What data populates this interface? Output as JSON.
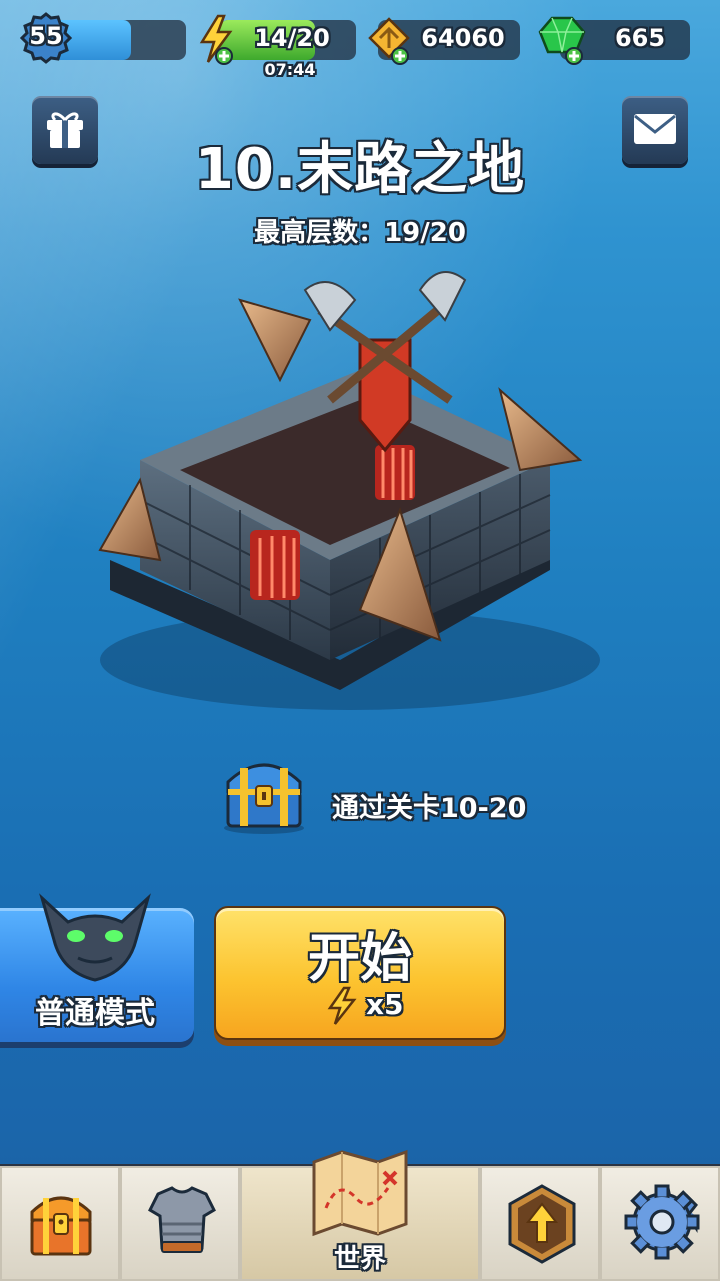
{
  "hud": {
    "player_level": "55",
    "xp_progress": 0.6,
    "energy": "14/20",
    "energy_progress": 0.7,
    "energy_timer": "07:44",
    "coins": "64060",
    "gems": "665"
  },
  "stage": {
    "title": "10.末路之地",
    "best_floor": "最高层数：19/20",
    "reward_text": "通过关卡10-20"
  },
  "actions": {
    "mode_label": "普通模式",
    "start_label": "开始",
    "start_cost": "x5"
  },
  "nav": {
    "active_label": "世界"
  },
  "colors": {
    "energy_green": "#3ea92d",
    "start_yellow": "#fcc430",
    "mode_blue": "#2f86e6",
    "gem_green": "#29c64a"
  },
  "icons": [
    "gift-icon",
    "mail-icon",
    "lightning-icon",
    "coin-icon",
    "gem-icon",
    "treasure-chest-icon",
    "armor-icon",
    "map-icon",
    "upgrade-arrow-icon",
    "gear-icon",
    "demon-mask-icon"
  ]
}
